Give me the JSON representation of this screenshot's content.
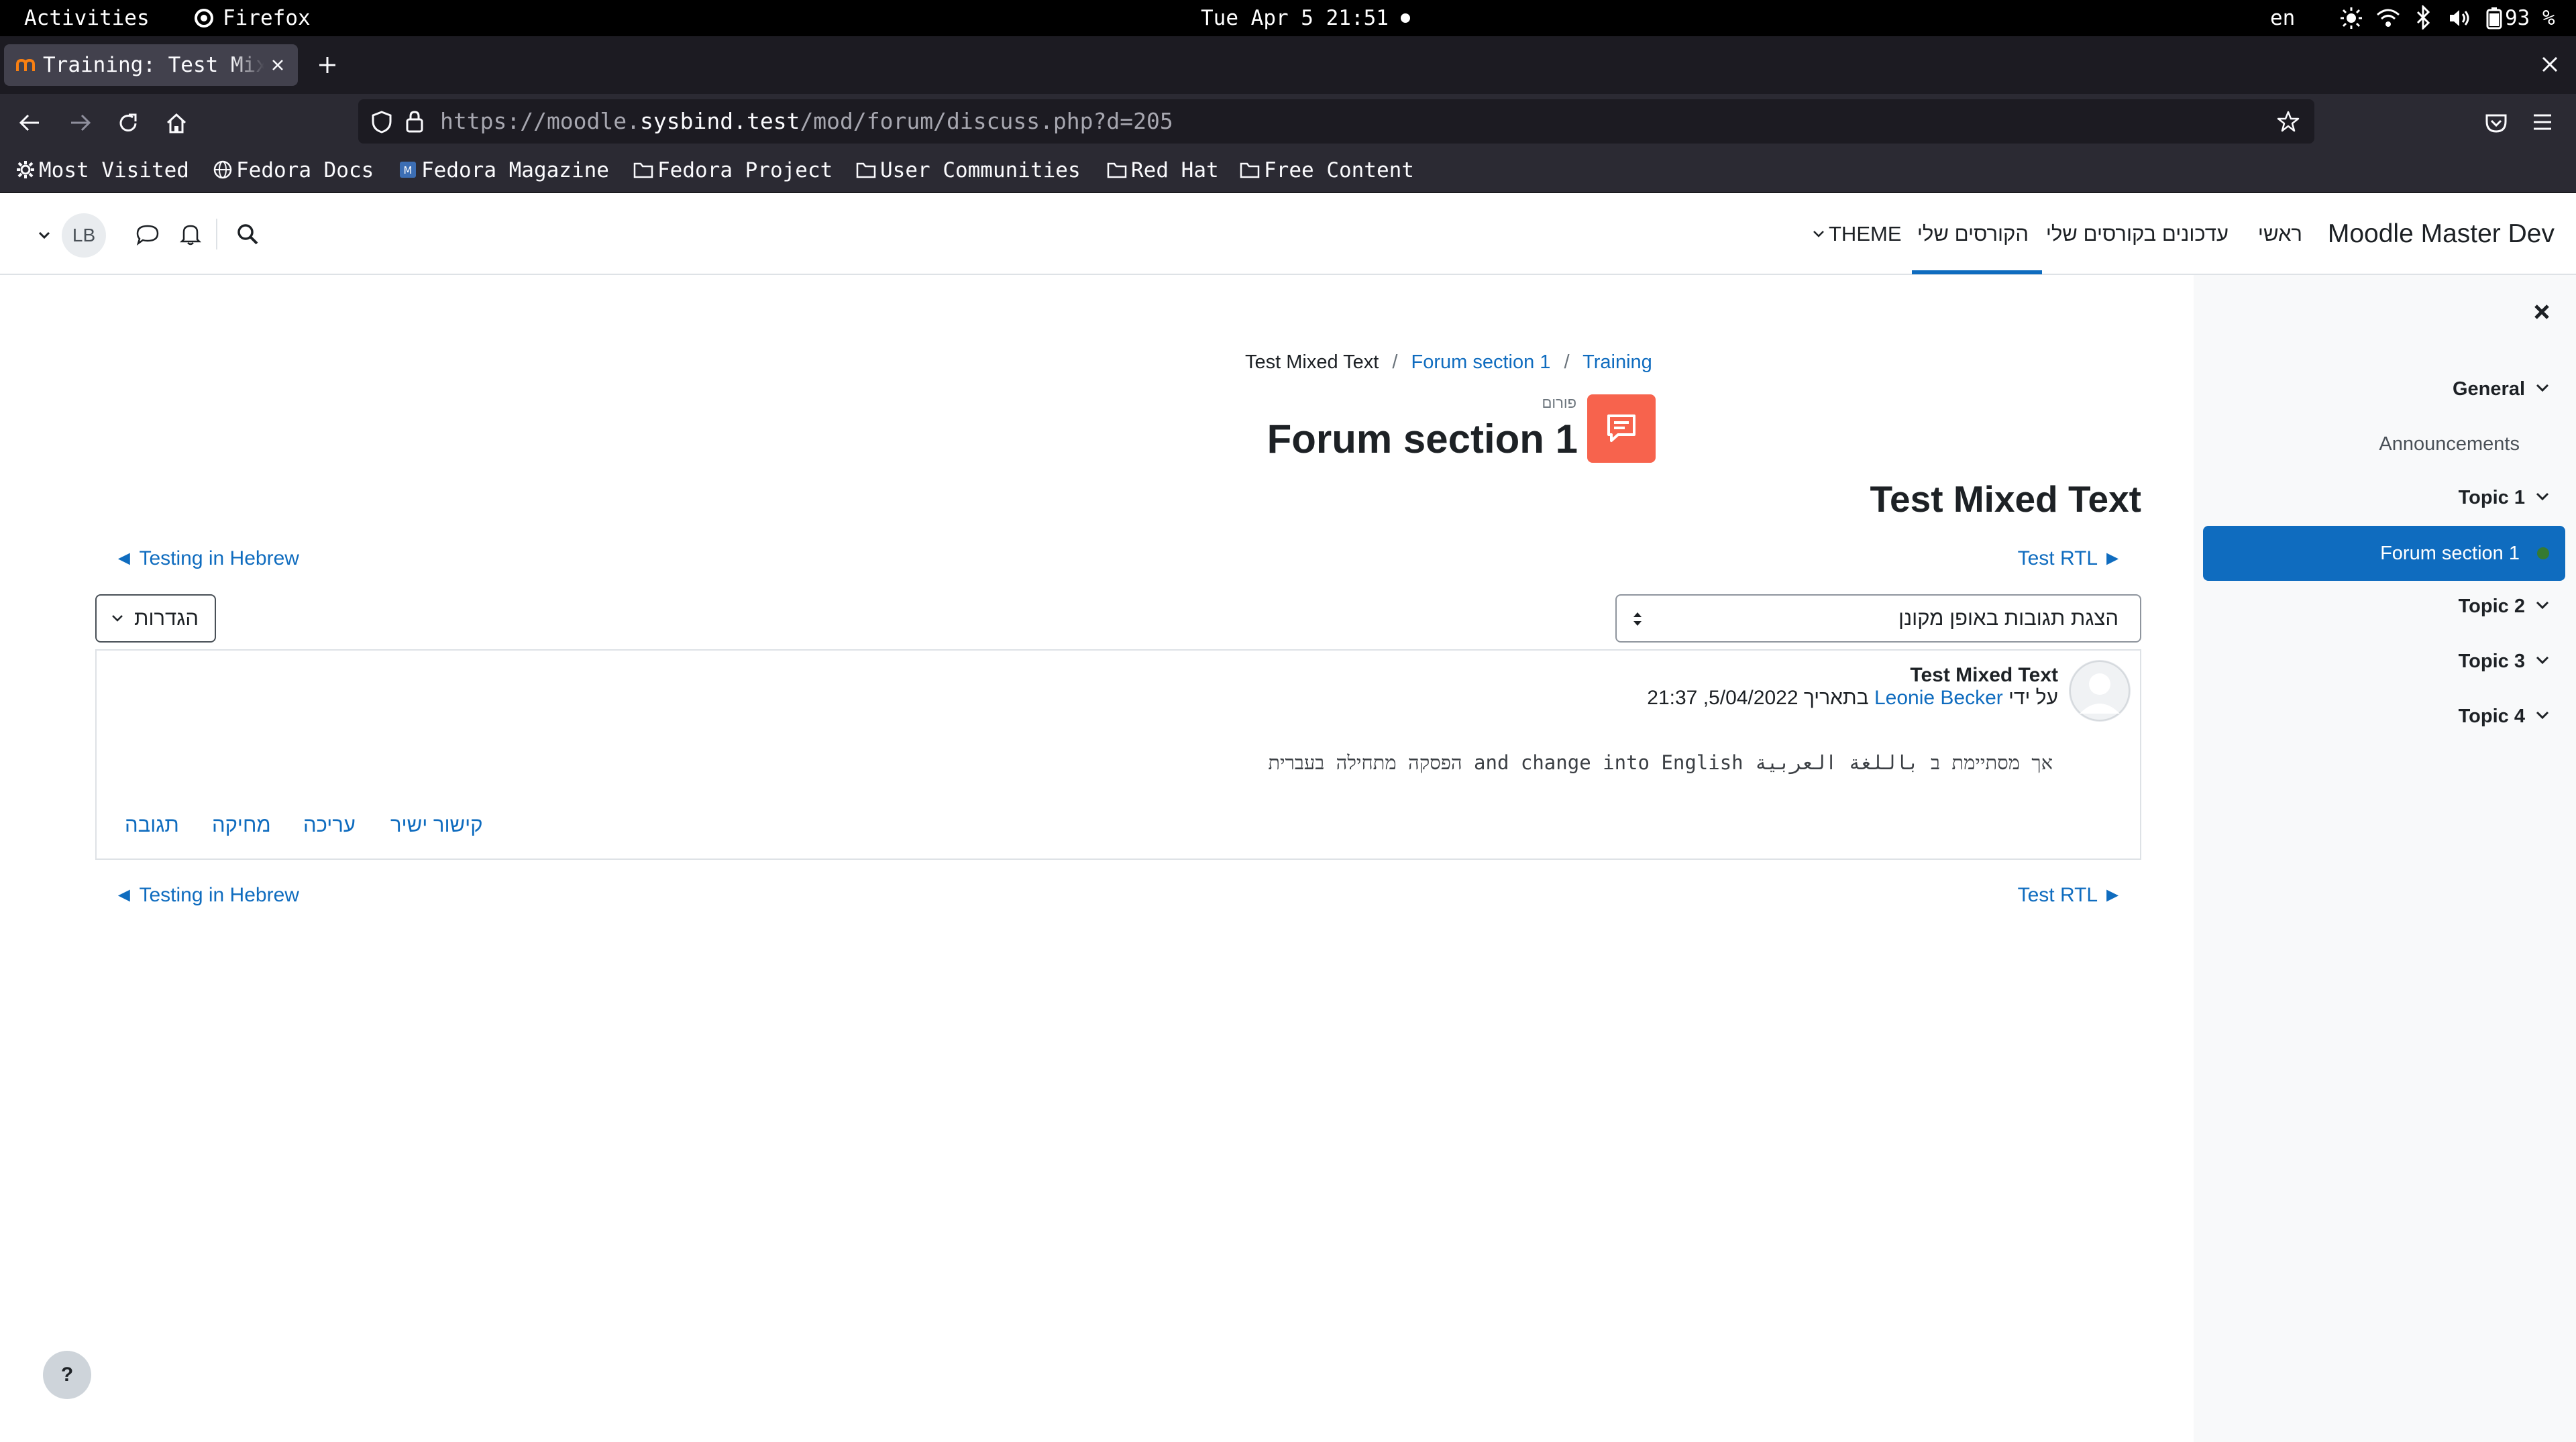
{
  "system": {
    "activities": "Activities",
    "app_name": "Firefox",
    "clock": "Tue Apr 5  21:51",
    "lang": "en",
    "battery": "93 %"
  },
  "browser": {
    "tab_title": "Training: Test Mixed Text",
    "url_scheme": "https://moodle.",
    "url_host": "sysbind.test",
    "url_path": "/mod/forum/discuss.php?d=205",
    "bookmarks": [
      "Most Visited",
      "Fedora Docs",
      "Fedora Magazine",
      "Fedora Project",
      "User Communities",
      "Red Hat",
      "Free Content"
    ]
  },
  "moodle_nav": {
    "site_name": "Moodle Master Dev",
    "home": "ראשי",
    "dashboard": "עדכונים בקורסים שלי",
    "my_courses": "הקורסים שלי",
    "theme": "THEME",
    "user_initials": "LB"
  },
  "course_index": {
    "items": [
      {
        "label": "General",
        "type": "section"
      },
      {
        "label": "Announcements",
        "type": "activity"
      },
      {
        "label": "Topic 1",
        "type": "section"
      },
      {
        "label": "Forum section 1",
        "type": "activity",
        "active": true
      },
      {
        "label": "Topic 2",
        "type": "section"
      },
      {
        "label": "Topic 3",
        "type": "section"
      },
      {
        "label": "Topic 4",
        "type": "section"
      }
    ]
  },
  "breadcrumb": {
    "current": "Test Mixed Text",
    "forum": "Forum section 1",
    "course": "Training"
  },
  "header": {
    "activity_type": "פורום",
    "title": "Forum section 1"
  },
  "discussion": {
    "title": "Test Mixed Text",
    "next_label": "Test RTL ►",
    "prev_label": "◄ Testing in Hebrew",
    "sort_value": "הצגת תגובות באופן מקונן",
    "settings_label": "הגדרות"
  },
  "post": {
    "subject": "Test Mixed Text",
    "by_prefix": "על ידי",
    "author": "Leonie Becker",
    "date_text": "בתאריך 5/04/2022, 21:37",
    "body": "הפסקה מתחילה בעברית and change into English אך מסתיימת ב باللغة العربية",
    "actions": {
      "permalink": "קישור ישיר",
      "edit": "עריכה",
      "delete": "מחיקה",
      "reply": "תגובה"
    }
  },
  "help_label": "?",
  "colors": {
    "primary": "#0f6cbf",
    "forum_icon": "#f7634d",
    "drawer_bg": "#f8f9fa",
    "topbar": "#000000",
    "browser_chrome": "#2b2a33"
  }
}
